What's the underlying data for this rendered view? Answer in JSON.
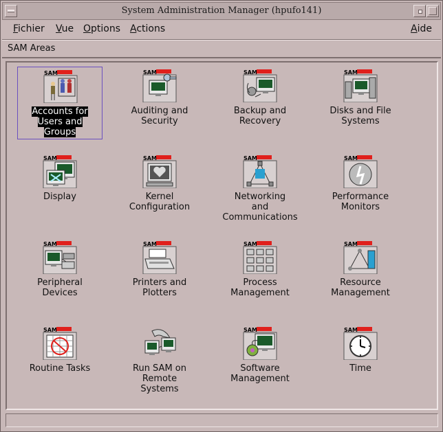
{
  "window": {
    "title": "System Administration Manager (hpufo141)"
  },
  "menubar": {
    "items": [
      {
        "label": "Fichier",
        "accel": "F",
        "rest": "ichier"
      },
      {
        "label": "Vue",
        "accel": "V",
        "rest": "ue"
      },
      {
        "label": "Options",
        "accel": "O",
        "rest": "ptions"
      },
      {
        "label": "Actions",
        "accel": "A",
        "rest": "ctions"
      },
      {
        "label": "Aide",
        "accel": "A",
        "rest": "ide"
      }
    ]
  },
  "area_bar": {
    "label": "SAM Areas"
  },
  "items": [
    {
      "lines": [
        "Accounts for",
        "Users and",
        "Groups"
      ],
      "icon": "accounts-icon",
      "selected": true
    },
    {
      "lines": [
        "Auditing and",
        "Security"
      ],
      "icon": "auditing-security-icon",
      "selected": false
    },
    {
      "lines": [
        "Backup and",
        "Recovery"
      ],
      "icon": "backup-recovery-icon",
      "selected": false
    },
    {
      "lines": [
        "Disks and File",
        "Systems"
      ],
      "icon": "disks-filesystems-icon",
      "selected": false
    },
    {
      "lines": [
        "Display"
      ],
      "icon": "display-icon",
      "selected": false
    },
    {
      "lines": [
        "Kernel",
        "Configuration"
      ],
      "icon": "kernel-configuration-icon",
      "selected": false
    },
    {
      "lines": [
        "Networking",
        "and",
        "Communications"
      ],
      "icon": "networking-icon",
      "selected": false
    },
    {
      "lines": [
        "Performance",
        "Monitors"
      ],
      "icon": "performance-monitors-icon",
      "selected": false
    },
    {
      "lines": [
        "Peripheral",
        "Devices"
      ],
      "icon": "peripheral-devices-icon",
      "selected": false
    },
    {
      "lines": [
        "Printers and",
        "Plotters"
      ],
      "icon": "printers-plotters-icon",
      "selected": false
    },
    {
      "lines": [
        "Process",
        "Management"
      ],
      "icon": "process-management-icon",
      "selected": false
    },
    {
      "lines": [
        "Resource",
        "Management"
      ],
      "icon": "resource-management-icon",
      "selected": false
    },
    {
      "lines": [
        "Routine Tasks"
      ],
      "icon": "routine-tasks-icon",
      "selected": false
    },
    {
      "lines": [
        "Run SAM on",
        "Remote",
        "Systems"
      ],
      "icon": "remote-systems-icon",
      "selected": false
    },
    {
      "lines": [
        "Software",
        "Management"
      ],
      "icon": "software-management-icon",
      "selected": false
    },
    {
      "lines": [
        "Time"
      ],
      "icon": "time-icon",
      "selected": false
    }
  ],
  "icon_badge": "SAM",
  "colors": {
    "background": "#c8b8b8",
    "selection_border": "#6a4fbf",
    "selection_fill": "#000000",
    "badge_red": "#e0201c",
    "screen_green": "#1a5a2a"
  }
}
